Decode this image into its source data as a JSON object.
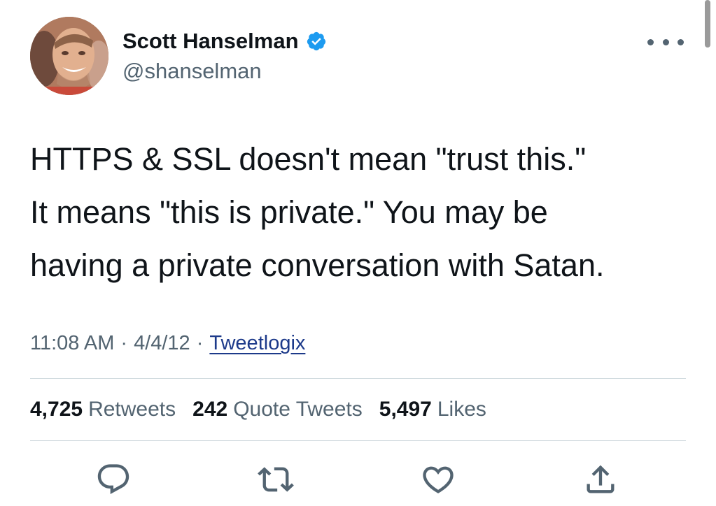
{
  "tweet": {
    "author": {
      "name": "Scott Hanselman",
      "handle": "@shanselman",
      "verified_color": "#1d9bf0"
    },
    "text_lines": [
      "HTTPS & SSL doesn't mean \"trust this.\"",
      "It means \"this is private.\" You may be",
      "having a private conversation with Satan."
    ],
    "meta": {
      "time": "11:08 AM",
      "separator": "·",
      "date": "4/4/12",
      "source": "Tweetlogix"
    },
    "stats": {
      "retweets": {
        "count": "4,725",
        "label": "Retweets"
      },
      "quotes": {
        "count": "242",
        "label": "Quote Tweets"
      },
      "likes": {
        "count": "5,497",
        "label": "Likes"
      }
    },
    "actions": [
      {
        "name": "reply",
        "icon": "reply-icon"
      },
      {
        "name": "retweet",
        "icon": "retweet-icon"
      },
      {
        "name": "like",
        "icon": "heart-icon"
      },
      {
        "name": "share",
        "icon": "share-icon"
      }
    ],
    "more_icon": "more-options-icon"
  },
  "colors": {
    "text": "#0f1419",
    "secondary": "#536471",
    "divider": "#cfd9de",
    "link": "#1d3a8a"
  }
}
